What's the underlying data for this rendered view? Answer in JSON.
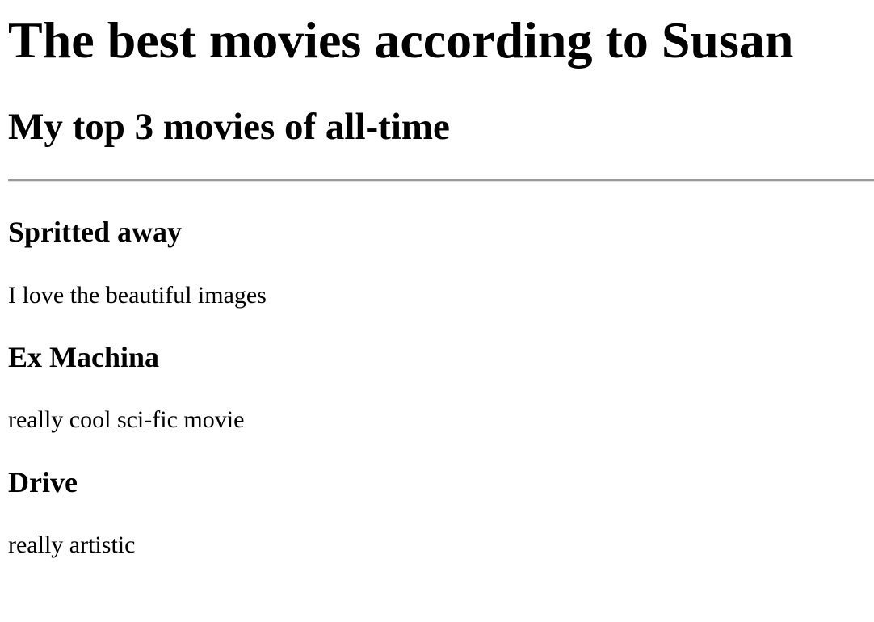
{
  "page": {
    "title": "The best movies according to Susan",
    "subtitle": "My top 3 movies of all-time"
  },
  "movies": [
    {
      "title": "Spritted away",
      "description": "I love the beautiful images"
    },
    {
      "title": "Ex Machina",
      "description": "really cool sci-fic movie"
    },
    {
      "title": "Drive",
      "description": "really artistic"
    }
  ]
}
